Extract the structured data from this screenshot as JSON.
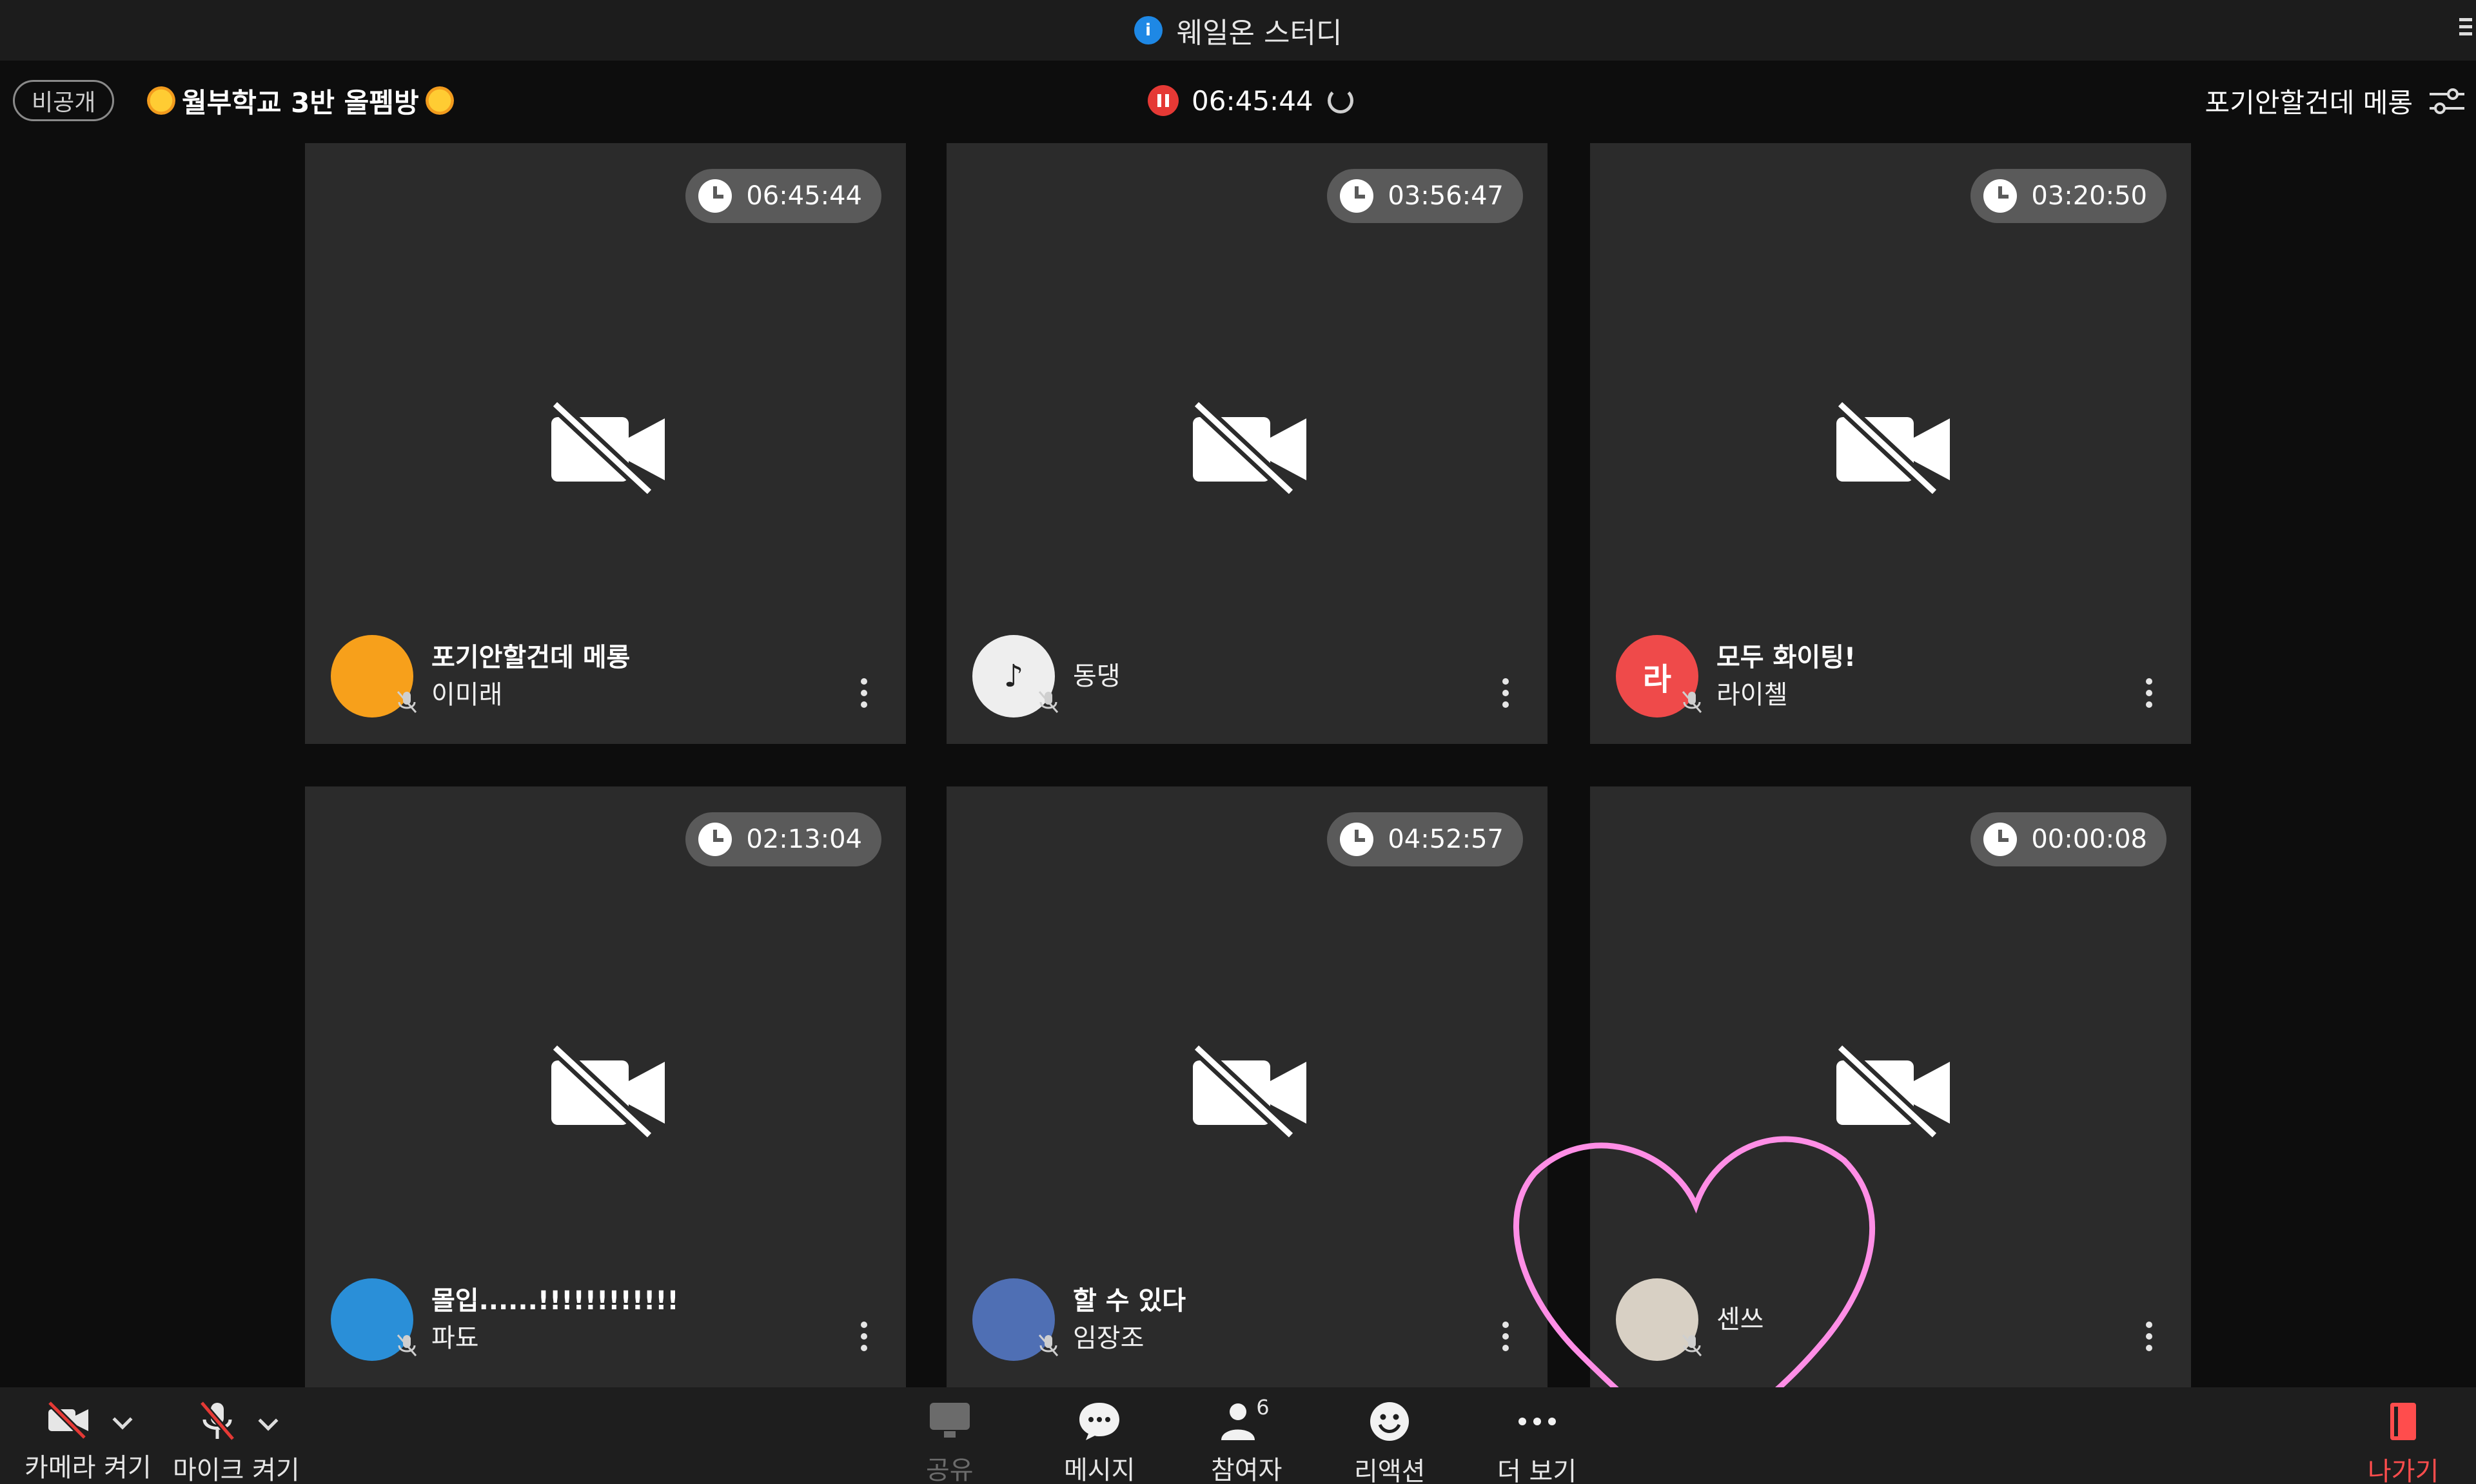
{
  "app": {
    "title": "웨일온 스터디",
    "icon": "whale-on-icon"
  },
  "room": {
    "visibility_badge": "비공개",
    "title": "월부학교 3반 올펨방",
    "elapsed": "06:45:44",
    "current_user": "포기안할건데 메롱",
    "accent_record": "#e53935"
  },
  "tiles": [
    {
      "timer": "06:45:44",
      "status": "포기안할건데 메롱",
      "name": "이미래",
      "avatar_color": "#f7a01b",
      "avatar_text": ""
    },
    {
      "timer": "03:56:47",
      "status": "",
      "name": "동댕",
      "avatar_color": "#eeeeee",
      "avatar_text": "♪"
    },
    {
      "timer": "03:20:50",
      "status": "모두 화이팅!",
      "name": "라이첼",
      "avatar_color": "#ef4a4a",
      "avatar_text": "라"
    },
    {
      "timer": "02:13:04",
      "status": "몰입......!!!!!!!!!!!!",
      "name": "파됴",
      "avatar_color": "#2a8fd8",
      "avatar_text": ""
    },
    {
      "timer": "04:52:57",
      "status": "할 수 있다",
      "name": "임장조",
      "avatar_color": "#4f6fb4",
      "avatar_text": ""
    },
    {
      "timer": "00:00:08",
      "status": "",
      "name": "센쓰",
      "avatar_color": "#d8d0c4",
      "avatar_text": ""
    }
  ],
  "toolbar": {
    "camera": "카메라 켜기",
    "mic": "마이크 켜기",
    "share": "공유",
    "message": "메시지",
    "participants": "참여자",
    "participants_count": "6",
    "reaction": "리액션",
    "more": "더 보기",
    "leave": "나가기",
    "leave_color": "#ff4d4d"
  }
}
